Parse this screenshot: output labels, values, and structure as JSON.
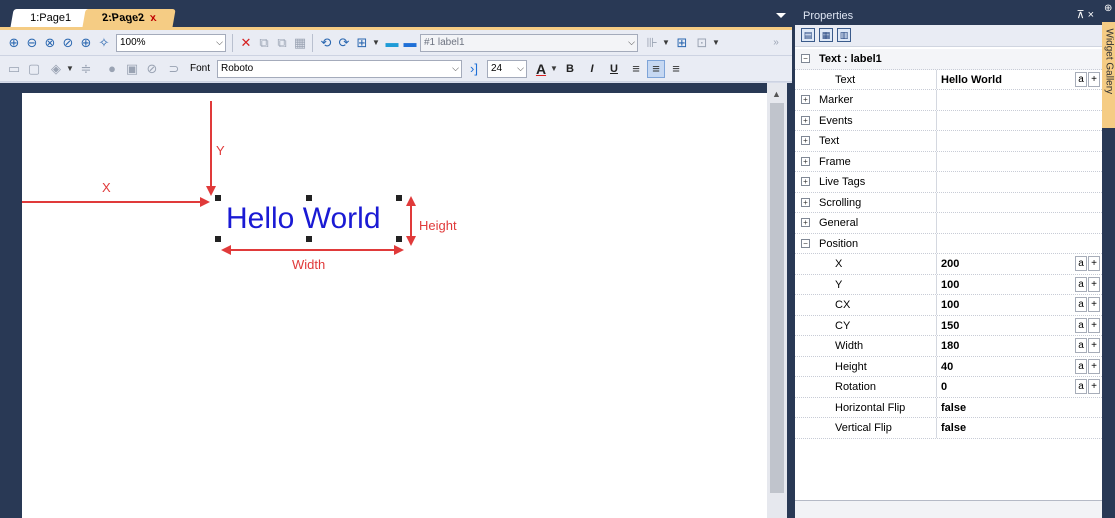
{
  "tabs": [
    {
      "label": "1:Page1",
      "active": false
    },
    {
      "label": "2:Page2",
      "active": true,
      "close": "x"
    }
  ],
  "toolbar": {
    "zoom": "100%",
    "object_select": "#1 label1",
    "font_label": "Font",
    "font_name": "Roboto",
    "font_size": "24",
    "bold": "B",
    "italic": "I",
    "underline": "U",
    "text_color": "A"
  },
  "canvas": {
    "label_text": "Hello World",
    "annotations": {
      "x": "X",
      "y": "Y",
      "width": "Width",
      "height": "Height"
    },
    "colors": {
      "label": "#1a1ad4",
      "annotation": "#e03a3a"
    }
  },
  "properties": {
    "title": "Properties",
    "pin": "⊼ ×",
    "group_header": "Text : label1",
    "text_row": {
      "key": "Text",
      "value": "Hello World"
    },
    "collapsed_groups": [
      "Marker",
      "Events",
      "Text",
      "Frame",
      "Live Tags",
      "Scrolling",
      "General"
    ],
    "position_group": "Position",
    "position_rows": [
      {
        "key": "X",
        "value": "200",
        "btns": true
      },
      {
        "key": "Y",
        "value": "100",
        "btns": true
      },
      {
        "key": "CX",
        "value": "100",
        "btns": true
      },
      {
        "key": "CY",
        "value": "150",
        "btns": true
      },
      {
        "key": "Width",
        "value": "180",
        "btns": true
      },
      {
        "key": "Height",
        "value": "40",
        "btns": true
      },
      {
        "key": "Rotation",
        "value": "0",
        "btns": true
      },
      {
        "key": "Horizontal Flip",
        "value": "false",
        "btns": false
      },
      {
        "key": "Vertical Flip",
        "value": "false",
        "btns": false
      }
    ],
    "btn_a": "a",
    "btn_plus": "+"
  },
  "sidebar": {
    "gallery_label": "Widget Gallery"
  }
}
